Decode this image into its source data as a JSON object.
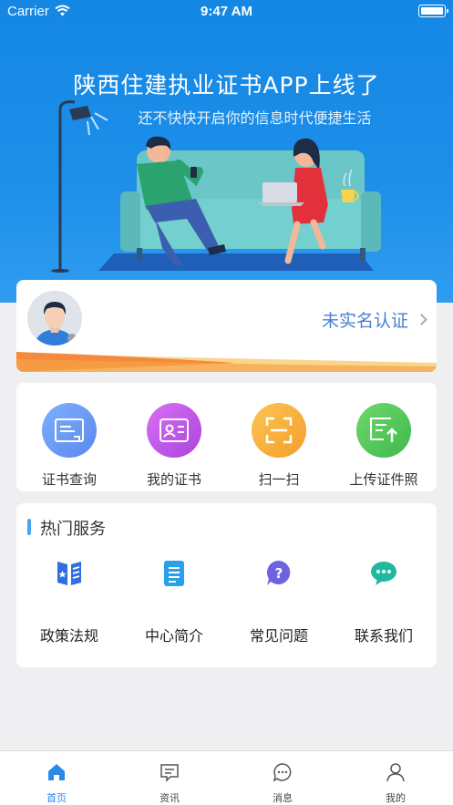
{
  "status_bar": {
    "carrier": "Carrier",
    "time": "9:47 AM"
  },
  "banner": {
    "title": "陕西住建执业证书APP上线了",
    "subtitle": "还不快快开启你的信息时代便捷生活"
  },
  "profile": {
    "verify_label": "未实名认证"
  },
  "quick_actions": [
    {
      "label": "证书查询",
      "icon": "certificate-search-icon",
      "color": "#6a9cf3"
    },
    {
      "label": "我的证书",
      "icon": "id-card-icon",
      "color": "#c15be8"
    },
    {
      "label": "扫一扫",
      "icon": "scan-icon",
      "color": "#f9b23d"
    },
    {
      "label": "上传证件照",
      "icon": "upload-photo-icon",
      "color": "#58c95a"
    }
  ],
  "hot_services": {
    "title": "热门服务",
    "items": [
      {
        "label": "政策法规",
        "icon": "policy-book-icon"
      },
      {
        "label": "中心简介",
        "icon": "document-icon"
      },
      {
        "label": "常见问题",
        "icon": "question-icon"
      },
      {
        "label": "联系我们",
        "icon": "chat-icon"
      }
    ]
  },
  "tab_bar": {
    "tabs": [
      {
        "label": "首页",
        "icon": "home-icon",
        "active": true
      },
      {
        "label": "资讯",
        "icon": "news-icon",
        "active": false
      },
      {
        "label": "消息",
        "icon": "message-icon",
        "active": false
      },
      {
        "label": "我的",
        "icon": "profile-icon",
        "active": false
      }
    ]
  },
  "colors": {
    "accent": "#2b8ae6",
    "banner": "#1d8fe9",
    "verify_text": "#4a7fd0"
  }
}
